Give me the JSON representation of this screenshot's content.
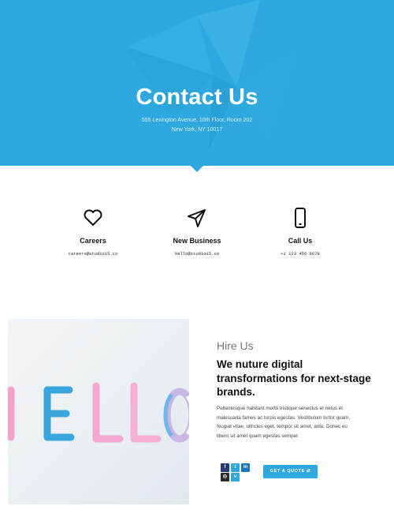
{
  "hero": {
    "title": "Contact Us",
    "address_line1": "555 Lexington Avenue, 10th Floor, Room 202",
    "address_line2": "New York, NY 10017"
  },
  "contacts": [
    {
      "icon": "heart-icon",
      "label": "Careers",
      "value": "careers@studio15.co"
    },
    {
      "icon": "paper-plane-icon",
      "label": "New Business",
      "value": "hello@studio15.co"
    },
    {
      "icon": "phone-icon",
      "label": "Call Us",
      "value": "+1 123 456 6678"
    }
  ],
  "hire": {
    "kicker": "Hire Us",
    "headline": "We nuture digital transformations for next-stage brands.",
    "body": "Pellentesque habitant morbi tristique senectus et netus et malesuada fames ac turpis egestas. Vestibulum tortor quam, feugiat vitae, ultricies eget, tempor sit amet, ante. Donec eu libero sit amet quam egestas semper.",
    "image_text": "HELLO",
    "cta_label": "GET A QUOTE ⇄"
  },
  "social": [
    {
      "icon": "facebook-icon",
      "glyph": "f"
    },
    {
      "icon": "twitter-icon",
      "glyph": "t"
    },
    {
      "icon": "linkedin-icon",
      "glyph": "in"
    },
    {
      "icon": "instagram-icon",
      "glyph": "◎"
    },
    {
      "icon": "vimeo-icon",
      "glyph": "v"
    }
  ],
  "colors": {
    "accent": "#2ea8df",
    "heading": "#111111",
    "muted": "#777777"
  }
}
